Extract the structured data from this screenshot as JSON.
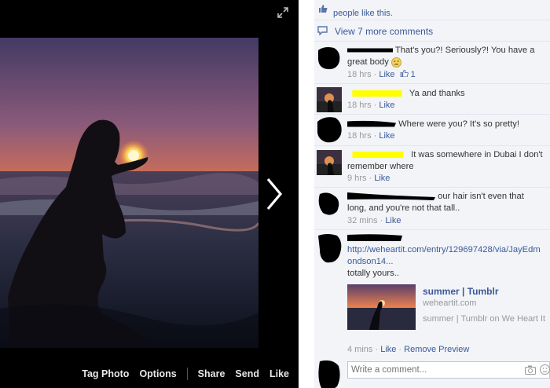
{
  "viewer": {
    "actions": {
      "tag_photo": "Tag Photo",
      "options": "Options",
      "share": "Share",
      "send": "Send",
      "like": "Like"
    },
    "icons": {
      "expand": "expand-icon",
      "next": "chevron-right-icon"
    }
  },
  "comments_panel": {
    "likes_text": "people like this.",
    "view_more": "View 7 more comments",
    "comments": [
      {
        "text": "That's you?! Seriously?! You have a great body",
        "time": "18 hrs",
        "like": "Like",
        "like_count": "1",
        "emoji": "smiley-icon"
      },
      {
        "text": "Ya and thanks",
        "time": "18 hrs",
        "like": "Like"
      },
      {
        "text": "Where were you? It's so pretty!",
        "time": "18 hrs",
        "like": "Like"
      },
      {
        "text": "It was somewhere in Dubai I don't remember where",
        "time": "9 hrs",
        "like": "Like"
      },
      {
        "text": "our hair isn't even that long, and you're not that tall..",
        "time": "32 mins",
        "like": "Like"
      },
      {
        "link": "http://weheartit.com/entry/129697428/via/JayEdmondson14...",
        "text": "totally yours..",
        "time": "4 mins",
        "like": "Like",
        "remove": "Remove Preview"
      }
    ],
    "preview": {
      "title": "summer | Tumblr",
      "domain": "weheartit.com",
      "description": "summer | Tumblr on We Heart It"
    },
    "compose": {
      "placeholder": "Write a comment..."
    }
  },
  "colors": {
    "link": "#3b5998",
    "meta": "#999999",
    "panel": "#f2f4f8",
    "highlight": "#ffff00"
  }
}
